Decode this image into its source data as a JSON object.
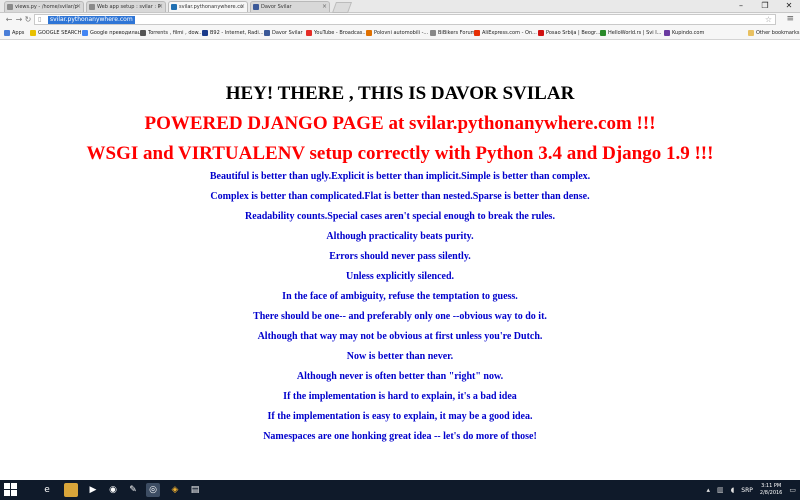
{
  "browser": {
    "tabs": [
      {
        "title": "views.py - /home/svilar/p"
      },
      {
        "title": "Web app setup : svilar : P"
      },
      {
        "title": "svilar.pythonanywhere.co"
      },
      {
        "title": "Davor Svilar"
      }
    ],
    "url": "svilar.pythonanywhere.com",
    "bookmarks": [
      {
        "label": "Apps",
        "color": "#4a7ed8"
      },
      {
        "label": "GOOGLE SEARCH",
        "color": "#e8c000"
      },
      {
        "label": "Google преводилац",
        "color": "#4285f4"
      },
      {
        "label": "Torrents , filmi , dow...",
        "color": "#555555"
      },
      {
        "label": "B92 - Internet, Radi...",
        "color": "#1a3a8a"
      },
      {
        "label": "Davor Svilar",
        "color": "#3b5998"
      },
      {
        "label": "YouTube - Broadcas...",
        "color": "#e52d27"
      },
      {
        "label": "Polovni automobili -...",
        "color": "#e07000"
      },
      {
        "label": "BiBikers Forum",
        "color": "#888888"
      },
      {
        "label": "AliExpress.com - On...",
        "color": "#e62e04"
      },
      {
        "label": "Posao Srbija | Beogr...",
        "color": "#d01010"
      },
      {
        "label": "HelloWorld.rs | Svi I...",
        "color": "#2a8a2a"
      },
      {
        "label": "Kupindo.com",
        "color": "#6a3aa0"
      }
    ],
    "other_bookmarks": "Other bookmarks"
  },
  "page": {
    "heading": "HEY! THERE , THIS IS DAVOR SVILAR",
    "powered": "POWERED DJANGO PAGE at svilar.pythonanywhere.com !!!",
    "setup": "WSGI and VIRTUALENV setup correctly with Python 3.4 and Django 1.9 !!!",
    "zen": [
      "Beautiful is better than ugly.Explicit is better than implicit.Simple is better than complex.",
      "Complex is better than complicated.Flat is better than nested.Sparse is better than dense.",
      "Readability counts.Special cases aren't special enough to break the rules.",
      "Although practicality beats purity.",
      "Errors should never pass silently.",
      "Unless explicitly silenced.",
      "In the face of ambiguity, refuse the temptation to guess.",
      "There should be one-- and preferably only one --obvious way to do it.",
      "Although that way may not be obvious at first unless you're Dutch.",
      "Now is better than never.",
      "Although never is often better than \"right\" now.",
      "If the implementation is hard to explain, it's a bad idea",
      "If the implementation is easy to explain, it may be a good idea.",
      "Namespaces are one honking great idea -- let's do more of those!"
    ],
    "colors": {
      "heading": "#000000",
      "accent": "#ff0000",
      "zen": "#0000cc"
    }
  },
  "taskbar": {
    "language": "SRP",
    "time": "3:11 PM",
    "date": "2/8/2016"
  }
}
